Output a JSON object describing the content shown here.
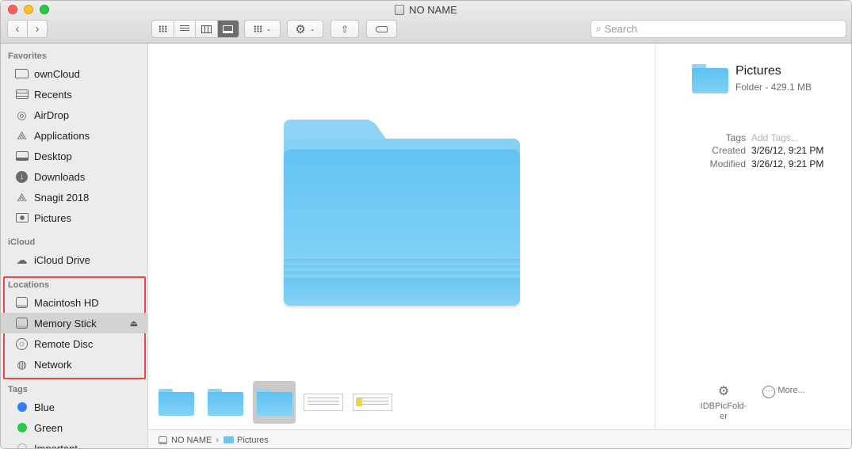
{
  "window": {
    "title": "NO NAME"
  },
  "toolbar": {
    "back": "‹",
    "forward": "›",
    "view_icons": [
      "icon-view",
      "list-view",
      "column-view",
      "gallery-view"
    ],
    "gear": "⚙",
    "caret": "⌄",
    "share": "⇧",
    "search_placeholder": "Search",
    "search_icon": "⌕"
  },
  "sidebar": {
    "favorites_header": "Favorites",
    "favorites": [
      {
        "label": "ownCloud",
        "icon": "folder-icon"
      },
      {
        "label": "Recents",
        "icon": "recents-icon"
      },
      {
        "label": "AirDrop",
        "icon": "airdrop-icon"
      },
      {
        "label": "Applications",
        "icon": "applications-icon"
      },
      {
        "label": "Desktop",
        "icon": "desktop-icon"
      },
      {
        "label": "Downloads",
        "icon": "downloads-icon"
      },
      {
        "label": "Snagit 2018",
        "icon": "snagit-icon"
      },
      {
        "label": "Pictures",
        "icon": "pictures-icon"
      }
    ],
    "icloud_header": "iCloud",
    "icloud": [
      {
        "label": "iCloud Drive",
        "icon": "cloud-icon"
      }
    ],
    "locations_header": "Locations",
    "locations": [
      {
        "label": "Macintosh HD",
        "icon": "hard-drive-icon"
      },
      {
        "label": "Memory Stick",
        "icon": "usb-drive-icon",
        "selected": true
      },
      {
        "label": "Remote Disc",
        "icon": "disc-icon"
      },
      {
        "label": "Network",
        "icon": "network-icon"
      }
    ],
    "eject": "⏏",
    "tags_header": "Tags",
    "tags": [
      {
        "label": "Blue",
        "color": "#2f7ff7"
      },
      {
        "label": "Green",
        "color": "#28c840"
      },
      {
        "label": "Important",
        "color": "#b0b0b0"
      }
    ]
  },
  "gallery": {
    "selected_item": "Pictures",
    "thumbnails": [
      "folder",
      "folder",
      "folder-selected",
      "document",
      "document-yellow"
    ]
  },
  "pathbar": {
    "drive": "NO NAME",
    "separator": "›",
    "folder": "Pictures"
  },
  "preview": {
    "name": "Pictures",
    "kind": "Folder - 429.1 MB",
    "tags_label": "Tags",
    "tags_placeholder": "Add Tags...",
    "created_label": "Created",
    "created_value": "3/26/12, 9:21 PM",
    "modified_label": "Modified",
    "modified_value": "3/26/12, 9:21 PM",
    "action_label": "IDBPicFold-er",
    "action_label_line1": "IDBPicFold-",
    "action_label_line2": "er",
    "more_label": "More...",
    "more_glyph": "···"
  }
}
